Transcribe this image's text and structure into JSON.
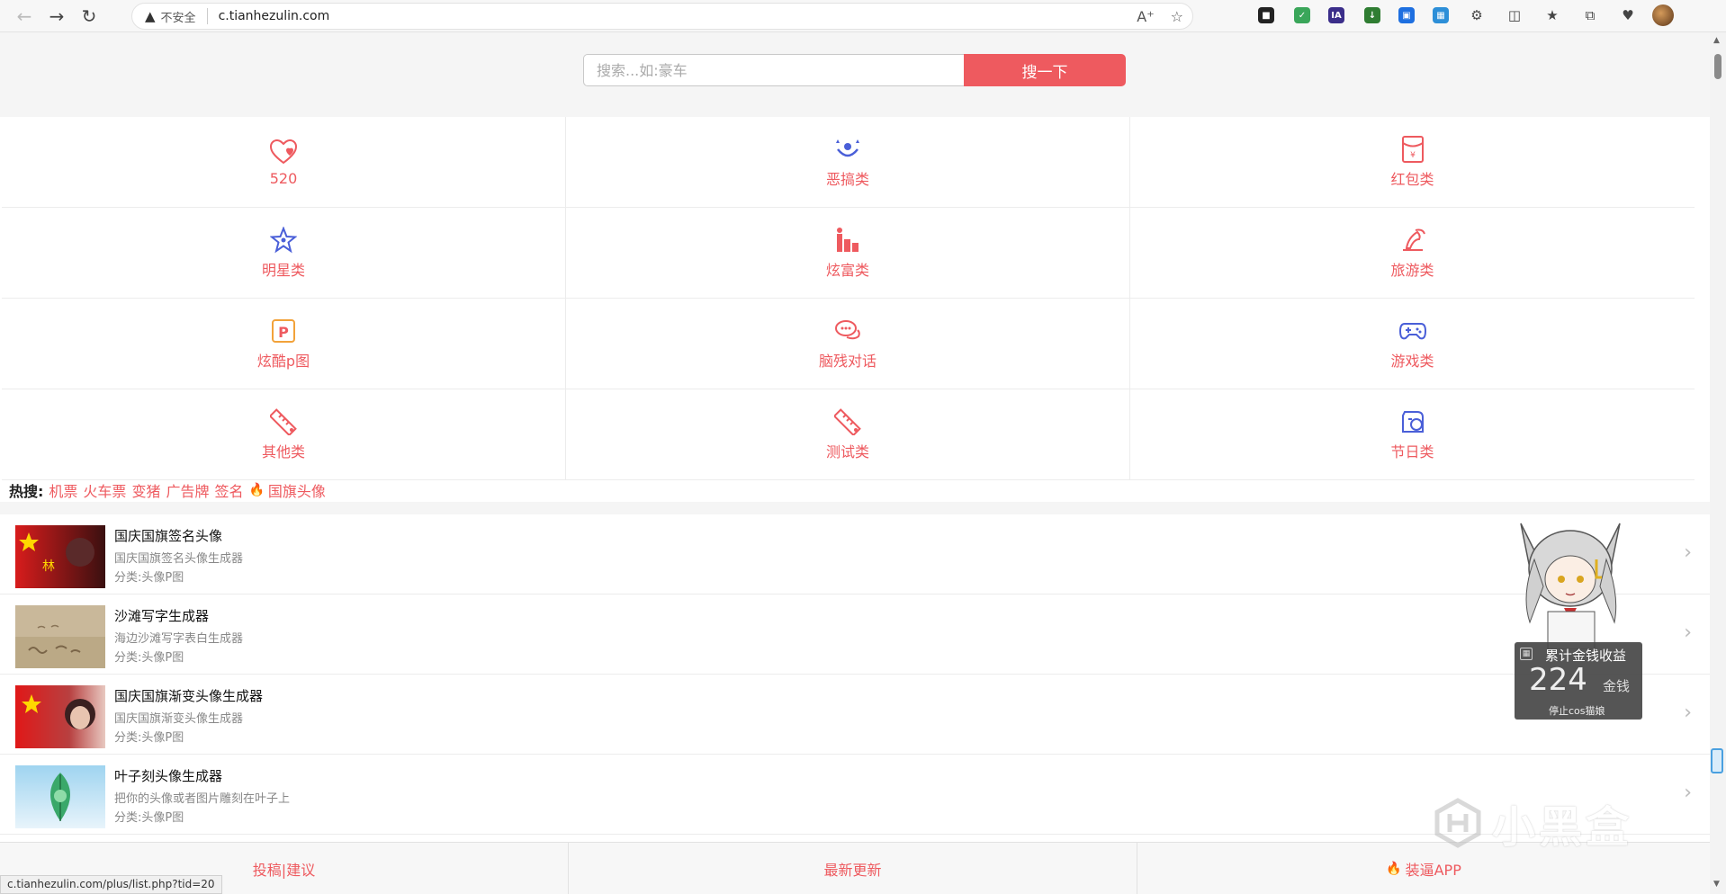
{
  "browser": {
    "insecure_label": "不安全",
    "url": "c.tianhezulin.com",
    "status_url": "c.tianhezulin.com/plus/list.php?tid=20"
  },
  "search": {
    "placeholder": "搜索...如:豪车",
    "button_label": "搜一下"
  },
  "categories": [
    {
      "label": "520",
      "icon": "heart-icon"
    },
    {
      "label": "恶搞类",
      "icon": "funny-face-icon"
    },
    {
      "label": "红包类",
      "icon": "red-envelope-icon"
    },
    {
      "label": "明星类",
      "icon": "star-icon"
    },
    {
      "label": "炫富类",
      "icon": "rich-icon"
    },
    {
      "label": "旅游类",
      "icon": "travel-icon"
    },
    {
      "label": "炫酷p图",
      "icon": "p-image-icon"
    },
    {
      "label": "脑残对话",
      "icon": "chat-icon"
    },
    {
      "label": "游戏类",
      "icon": "gamepad-icon"
    },
    {
      "label": "其他类",
      "icon": "ruler-icon"
    },
    {
      "label": "测试类",
      "icon": "ruler-icon"
    },
    {
      "label": "节日类",
      "icon": "festival-icon"
    }
  ],
  "hot": {
    "title": "热搜:",
    "tags": [
      "机票",
      "火车票",
      "变猪",
      "广告牌",
      "签名"
    ],
    "highlight_tag": "国旗头像"
  },
  "items": [
    {
      "title": "国庆国旗签名头像",
      "desc": "国庆国旗签名头像生成器",
      "category": "分类:头像P图"
    },
    {
      "title": "沙滩写字生成器",
      "desc": "海边沙滩写字表白生成器",
      "category": "分类:头像P图"
    },
    {
      "title": "国庆国旗渐变头像生成器",
      "desc": "国庆国旗渐变头像生成器",
      "category": "分类:头像P图"
    },
    {
      "title": "叶子刻头像生成器",
      "desc": "把你的头像或者图片雕刻在叶子上",
      "category": "分类:头像P图"
    }
  ],
  "footer": {
    "submit": "投稿|建议",
    "latest": "最新更新",
    "app": "装逼APP"
  },
  "widget": {
    "title": "累计金钱收益",
    "amount": "224",
    "unit": "金钱",
    "stop": "停止cos猫娘"
  },
  "watermark": "小黑盒",
  "colors": {
    "accent": "#ee5a5f",
    "icon_blue": "#4a5fd8",
    "flame": "#f28a1a"
  }
}
